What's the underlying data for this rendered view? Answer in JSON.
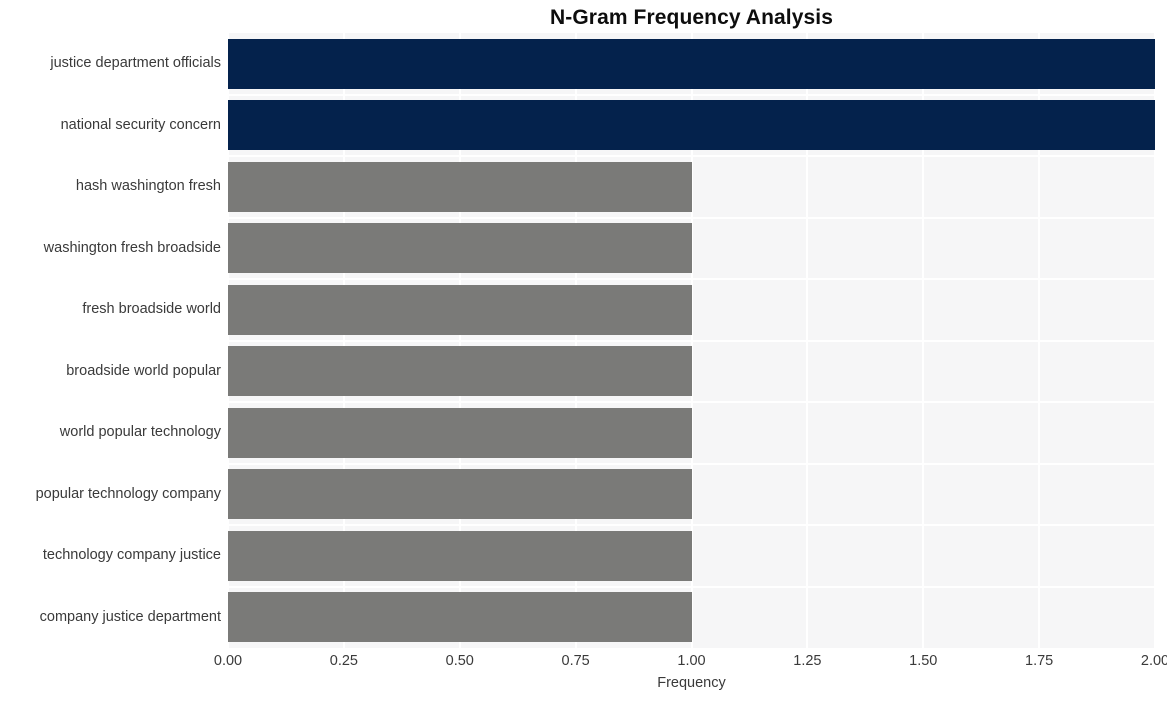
{
  "chart_data": {
    "type": "bar",
    "orientation": "horizontal",
    "title": "N-Gram Frequency Analysis",
    "xlabel": "Frequency",
    "ylabel": "",
    "xlim": [
      0,
      2.0
    ],
    "xticks": [
      "0.00",
      "0.25",
      "0.50",
      "0.75",
      "1.00",
      "1.25",
      "1.50",
      "1.75",
      "2.00"
    ],
    "xtick_values": [
      0,
      0.25,
      0.5,
      0.75,
      1.0,
      1.25,
      1.5,
      1.75,
      2.0
    ],
    "grid": true,
    "legend": "none",
    "categories": [
      "justice department officials",
      "national security concern",
      "hash washington fresh",
      "washington fresh broadside",
      "fresh broadside world",
      "broadside world popular",
      "world popular technology",
      "popular technology company",
      "technology company justice",
      "company justice department"
    ],
    "values": [
      2,
      2,
      1,
      1,
      1,
      1,
      1,
      1,
      1,
      1
    ],
    "bar_colors": [
      "#04224c",
      "#04224c",
      "#7a7a78",
      "#7a7a78",
      "#7a7a78",
      "#7a7a78",
      "#7a7a78",
      "#7a7a78",
      "#7a7a78",
      "#7a7a78"
    ],
    "palette": {
      "highlight": "#04224c",
      "normal": "#7a7a78",
      "plot_background": "#f6f6f7",
      "grid_color": "#ffffff",
      "figure_background": "#ffffff",
      "text_color": "#3a3a3a",
      "title_color": "#0d0d0d"
    }
  }
}
